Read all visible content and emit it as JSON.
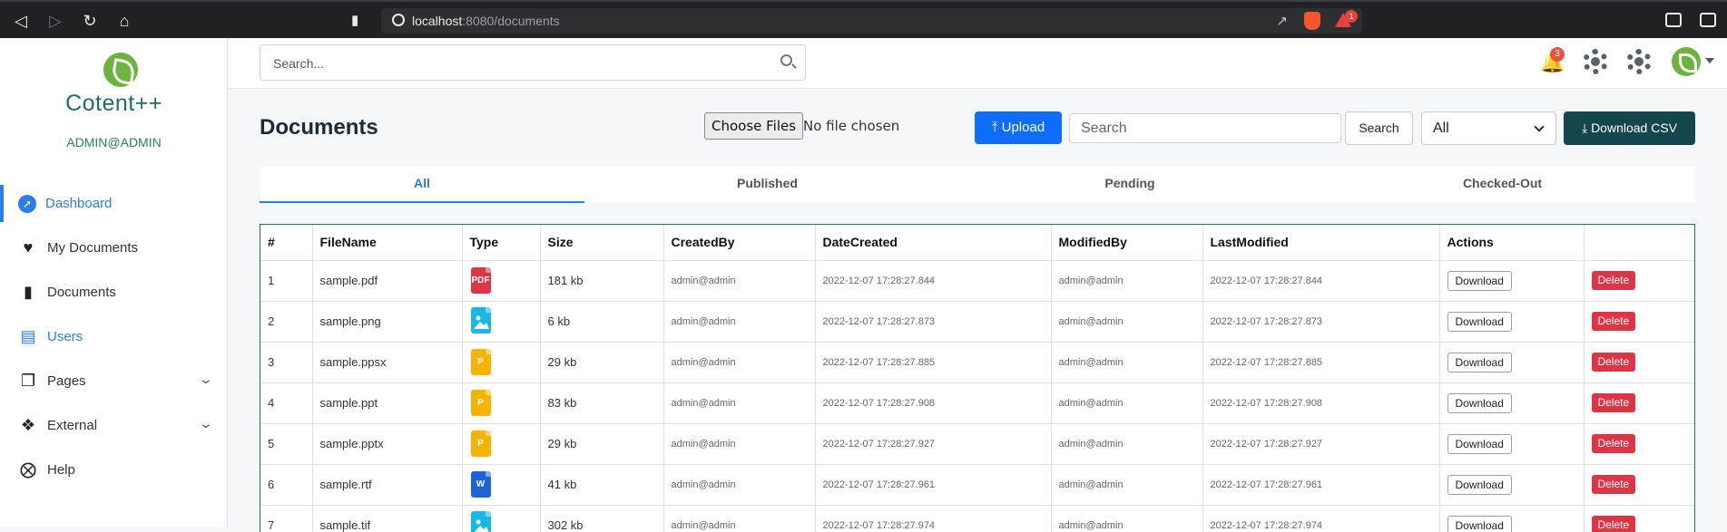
{
  "browser": {
    "url_host": "localhost",
    "url_path": ":8080/documents",
    "extension_badge": "1"
  },
  "sidebar": {
    "brand": "Cotent++",
    "user": "ADMIN@ADMIN",
    "items": [
      {
        "label": "Dashboard",
        "icon": "dashboard-icon"
      },
      {
        "label": "My Documents",
        "icon": "heartbeat-icon"
      },
      {
        "label": "Documents",
        "icon": "file-icon"
      },
      {
        "label": "Users",
        "icon": "users-icon"
      },
      {
        "label": "Pages",
        "icon": "pages-icon"
      },
      {
        "label": "External",
        "icon": "external-icon"
      },
      {
        "label": "Help",
        "icon": "help-icon"
      }
    ]
  },
  "topbar": {
    "search_placeholder": "Search...",
    "notification_count": "3"
  },
  "main": {
    "title": "Documents",
    "choose_files": "Choose Files",
    "no_file": "No file chosen",
    "upload": "Upload",
    "search_placeholder": "Search",
    "search_button": "Search",
    "filter_value": "All",
    "download_csv": "Download CSV",
    "tabs": [
      "All",
      "Published",
      "Pending",
      "Checked-Out"
    ]
  },
  "table": {
    "headers": [
      "#",
      "FileName",
      "Type",
      "Size",
      "CreatedBy",
      "DateCreated",
      "ModifiedBy",
      "LastModified",
      "Actions",
      ""
    ],
    "download_label": "Download",
    "delete_label": "Delete",
    "rows": [
      {
        "n": "1",
        "name": "sample.pdf",
        "type": "pdf",
        "type_color": "#dc3545",
        "type_text": "PDF",
        "size": "181 kb",
        "created_by": "admin@admin",
        "date_created": "2022-12-07 17:28:27.844",
        "modified_by": "admin@admin",
        "last_modified": "2022-12-07 17:28:27.844"
      },
      {
        "n": "2",
        "name": "sample.png",
        "type": "image",
        "type_color": "#17b8e8",
        "type_text": "",
        "size": "6 kb",
        "created_by": "admin@admin",
        "date_created": "2022-12-07 17:28:27.873",
        "modified_by": "admin@admin",
        "last_modified": "2022-12-07 17:28:27.873"
      },
      {
        "n": "3",
        "name": "sample.ppsx",
        "type": "slides",
        "type_color": "#f6b400",
        "type_text": "P",
        "size": "29 kb",
        "created_by": "admin@admin",
        "date_created": "2022-12-07 17:28:27.885",
        "modified_by": "admin@admin",
        "last_modified": "2022-12-07 17:28:27.885"
      },
      {
        "n": "4",
        "name": "sample.ppt",
        "type": "slides",
        "type_color": "#f6b400",
        "type_text": "P",
        "size": "83 kb",
        "created_by": "admin@admin",
        "date_created": "2022-12-07 17:28:27.908",
        "modified_by": "admin@admin",
        "last_modified": "2022-12-07 17:28:27.908"
      },
      {
        "n": "5",
        "name": "sample.pptx",
        "type": "slides",
        "type_color": "#f6b400",
        "type_text": "P",
        "size": "29 kb",
        "created_by": "admin@admin",
        "date_created": "2022-12-07 17:28:27.927",
        "modified_by": "admin@admin",
        "last_modified": "2022-12-07 17:28:27.927"
      },
      {
        "n": "6",
        "name": "sample.rtf",
        "type": "word",
        "type_color": "#1a63d8",
        "type_text": "W",
        "size": "41 kb",
        "created_by": "admin@admin",
        "date_created": "2022-12-07 17:28:27.961",
        "modified_by": "admin@admin",
        "last_modified": "2022-12-07 17:28:27.961"
      },
      {
        "n": "7",
        "name": "sample.tif",
        "type": "image",
        "type_color": "#17b8e8",
        "type_text": "",
        "size": "302 kb",
        "created_by": "admin@admin",
        "date_created": "2022-12-07 17:28:27.974",
        "modified_by": "admin@admin",
        "last_modified": "2022-12-07 17:28:27.974"
      }
    ]
  }
}
